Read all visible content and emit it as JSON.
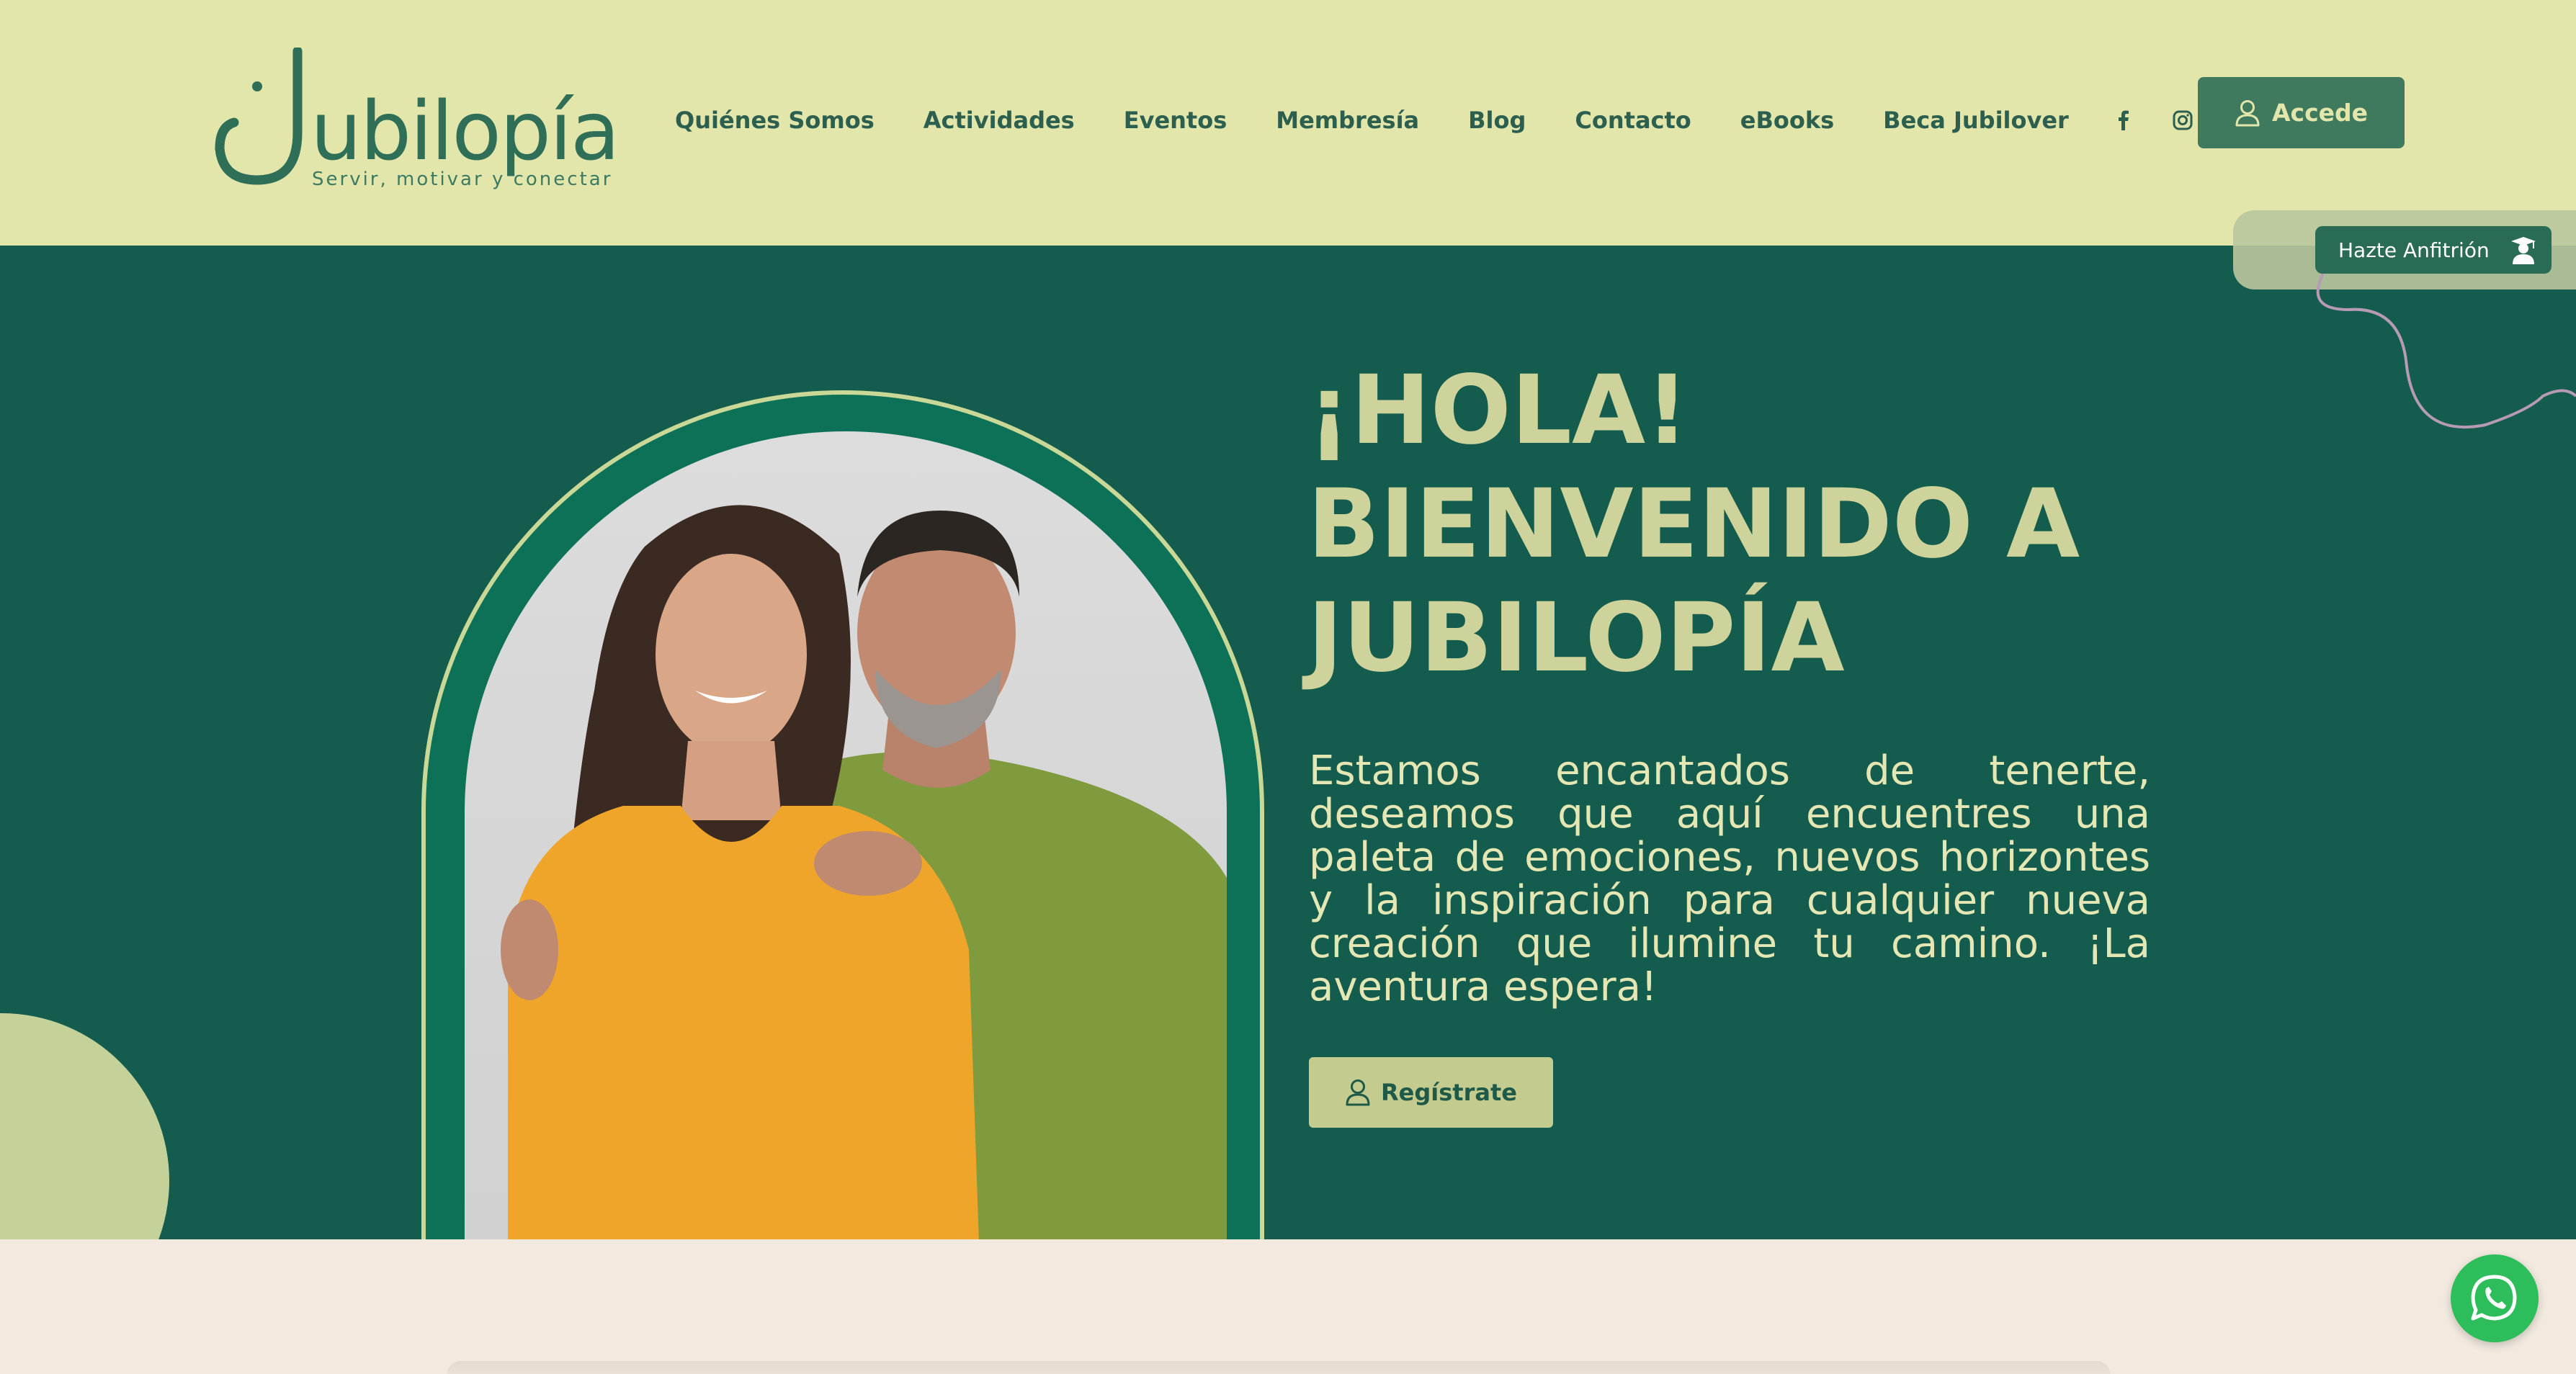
{
  "brand": {
    "name": "Jubilopía",
    "name_word": "ubilopía",
    "tagline": "Servir, motivar y conectar"
  },
  "nav": {
    "items": [
      {
        "label": "Quiénes Somos"
      },
      {
        "label": "Actividades"
      },
      {
        "label": "Eventos"
      },
      {
        "label": "Membresía"
      },
      {
        "label": "Blog"
      },
      {
        "label": "Contacto"
      },
      {
        "label": "eBooks"
      },
      {
        "label": "Beca Jubilover"
      }
    ],
    "social": [
      "facebook-icon",
      "instagram-icon"
    ]
  },
  "header": {
    "login_label": "Accede"
  },
  "side_tab": {
    "label": "Hazte Anfitrión"
  },
  "hero": {
    "title_line1": "¡HOLA!",
    "title_line2": "BIENVENIDO A",
    "title_line3": "JUBILOPÍA",
    "text": "Estamos encantados de tenerte, deseamos que aquí encuentres una paleta de emociones, nuevos horizontes y la inspiración para cualquier nueva creación que ilumine tu camino. ¡La aventura espera!",
    "cta_label": "Regístrate"
  },
  "colors": {
    "header_bg": "#e2e6ab",
    "hero_bg": "#145c4d",
    "accent": "#3f7a5e",
    "hero_title": "#cdd39a",
    "whatsapp": "#2dbd5a"
  }
}
